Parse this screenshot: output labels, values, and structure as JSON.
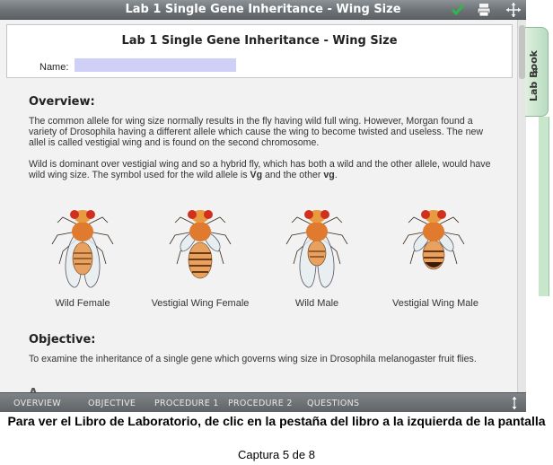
{
  "window": {
    "title": "Lab 1  Single Gene Inheritance - Wing Size",
    "icons": [
      "checkmark-icon",
      "print-icon",
      "move-icon"
    ]
  },
  "header": {
    "lab_title": "Lab 1  Single Gene Inheritance - Wing Size",
    "name_label": "Name:",
    "name_value": ""
  },
  "overview": {
    "heading": "Overview:",
    "para1": "The common allele for wing size normally results in the fly having wild full wing. However, Morgan found a variety of Drosophila having a different allele which cause the wing to become twisted and useless. The new allel is called vestigial wing and is found on the second chromosome.",
    "para2_prefix": "Wild is dominant over vestigial wing and so a hybrid fly, which has both a wild and the other allele, would have wild wing size. The symbol used for the wild allele is ",
    "wild_symbol": "Vg",
    "para2_middle": " and the other ",
    "other_symbol": "vg",
    "para2_suffix": "."
  },
  "flies": [
    {
      "label": "Wild Female",
      "wing": "wild"
    },
    {
      "label": "Vestigial Wing Female",
      "wing": "vestigial"
    },
    {
      "label": "Wild Male",
      "wing": "wild"
    },
    {
      "label": "Vestigial Wing Male",
      "wing": "vestigial"
    }
  ],
  "objective": {
    "heading": "Objective:",
    "text": "To examine the inheritance of a single gene which governs wing size in Drosophila melanogaster fruit flies."
  },
  "nav": {
    "items": [
      "OVERVIEW",
      "OBJECTIVE",
      "PROCEDURE 1",
      "PROCEDURE 2",
      "QUESTIONS"
    ]
  },
  "labbook": {
    "label": "Lab Book",
    "chevron": "«"
  },
  "caption": {
    "main": "Para ver el Libro de Laboratorio, de clic en la pestaña del libro a la izquierda de la pantalla",
    "sub": "Captura 5 de 8"
  },
  "colors": {
    "titlebar": "#6d7276",
    "name_field": "#cfd0f7",
    "labbook_tab": "#c8e6cc",
    "fly_body": "#e07a2e",
    "fly_eye": "#d0301e"
  }
}
